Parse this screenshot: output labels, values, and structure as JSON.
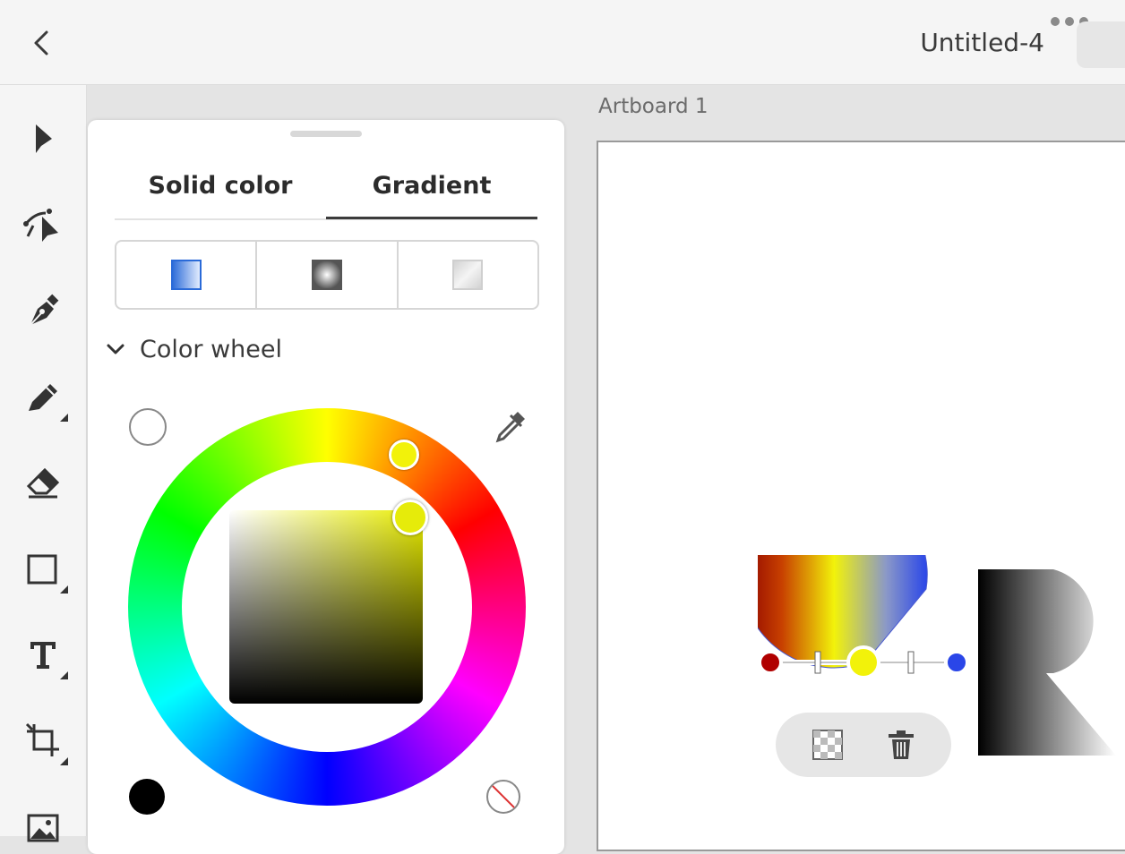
{
  "header": {
    "title": "Untitled-4"
  },
  "toolbar": {
    "tools": [
      "select",
      "direct-select",
      "pen",
      "pencil",
      "eraser",
      "rectangle",
      "text",
      "transform",
      "image"
    ]
  },
  "artboard": {
    "label": "Artboard 1"
  },
  "color_panel": {
    "tabs": [
      {
        "label": "Solid color",
        "active": false
      },
      {
        "label": "Gradient",
        "active": true
      }
    ],
    "gradient_types": [
      "linear-gradient-icon",
      "radial-gradient-icon",
      "freeform-gradient-icon"
    ],
    "selected_gradient_type": "linear",
    "section": {
      "label": "Color wheel",
      "expanded": true
    },
    "current_color": "#e6eb0a",
    "hue_color": "#f2f20a"
  },
  "gradient_stops": [
    {
      "color": "#b00000"
    },
    {
      "color": "#f2f20a"
    },
    {
      "color": "#2a46e8"
    }
  ],
  "colors": {
    "accent": "#2a6ad8",
    "stop_red": "#b00000",
    "stop_yellow": "#f2f20a",
    "stop_blue": "#2a46e8"
  }
}
